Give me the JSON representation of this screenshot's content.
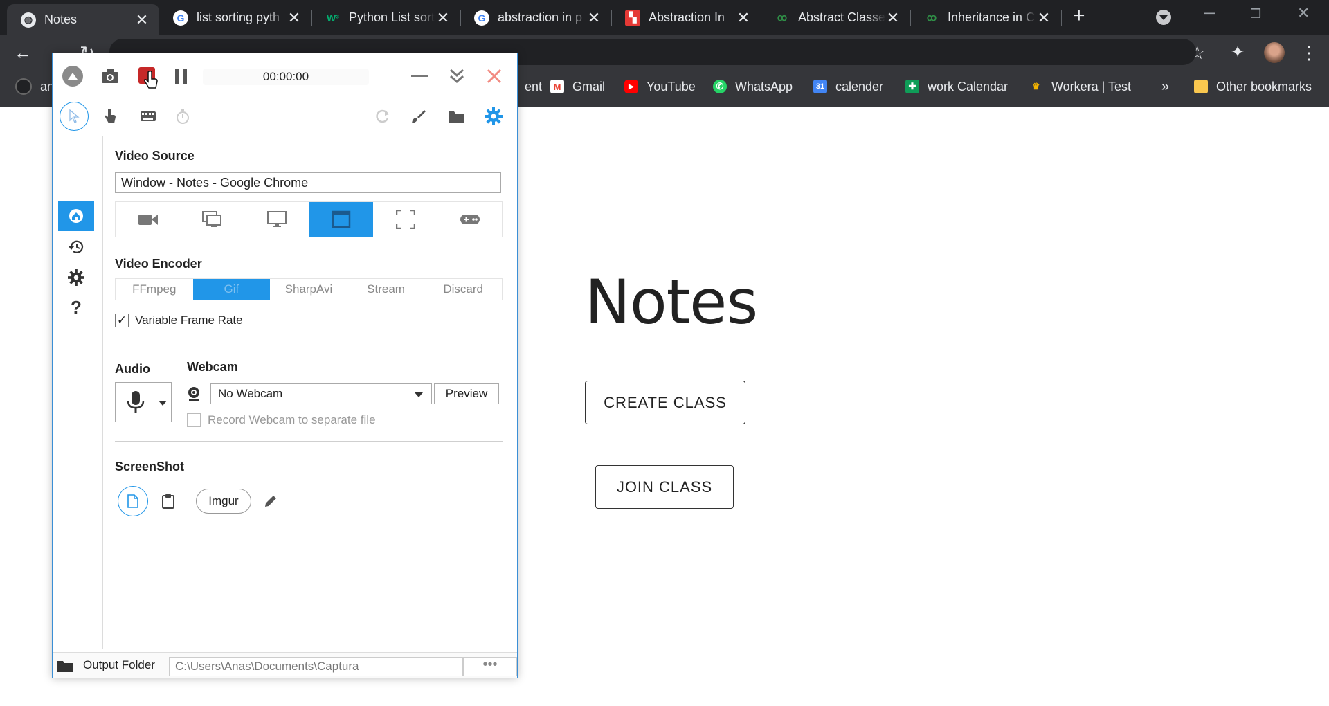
{
  "browser": {
    "tabs": [
      {
        "title": "Notes",
        "favicon": "globe-icon",
        "active": true
      },
      {
        "title": "list sorting pyth",
        "favicon": "google-icon"
      },
      {
        "title": "Python List sort",
        "favicon": "w3-icon"
      },
      {
        "title": "abstraction in p",
        "favicon": "google-icon"
      },
      {
        "title": "Abstraction In",
        "favicon": "site-icon"
      },
      {
        "title": "Abstract Classe",
        "favicon": "gfg-icon"
      },
      {
        "title": "Inheritance in C",
        "favicon": "gfg-icon"
      }
    ],
    "bookmarks": [
      {
        "label": "an",
        "icon": "github-icon"
      },
      {
        "label": "ent",
        "icon": ""
      },
      {
        "label": "Gmail",
        "icon": "gmail-icon",
        "color": "#ea4335"
      },
      {
        "label": "YouTube",
        "icon": "youtube-icon",
        "color": "#ff0000"
      },
      {
        "label": "WhatsApp",
        "icon": "whatsapp-icon",
        "color": "#25d366"
      },
      {
        "label": "calender",
        "icon": "calendar-icon",
        "color": "#4285f4"
      },
      {
        "label": "work Calendar",
        "icon": "sheets-icon",
        "color": "#0f9d58"
      },
      {
        "label": "Workera | Test",
        "icon": "workera-icon",
        "color": "#f4b400"
      },
      {
        "label": "»",
        "icon": ""
      },
      {
        "label": "Other bookmarks",
        "icon": "folder-icon",
        "color": "#f9c74f"
      }
    ]
  },
  "page": {
    "title": "Notes",
    "create_class": "CREATE CLASS",
    "join_class": "JOIN CLASS"
  },
  "captura": {
    "timer": "00:00:00",
    "video_source_heading": "Video Source",
    "video_source_value": "Window  -  Notes - Google Chrome",
    "video_encoder_heading": "Video Encoder",
    "encoders": [
      "FFmpeg",
      "Gif",
      "SharpAvi",
      "Stream",
      "Discard"
    ],
    "active_encoder": "Gif",
    "variable_frame_rate": "Variable Frame Rate",
    "audio_heading": "Audio",
    "webcam_heading": "Webcam",
    "webcam_value": "No Webcam",
    "preview_label": "Preview",
    "record_webcam_label": "Record Webcam to separate file",
    "screenshot_heading": "ScreenShot",
    "imgur_label": "Imgur",
    "output_folder_label": "Output Folder",
    "output_folder_path": "C:\\Users\\Anas\\Documents\\Captura",
    "more_label": "•••",
    "accent": "#2196e8",
    "record_color": "#c62828"
  }
}
